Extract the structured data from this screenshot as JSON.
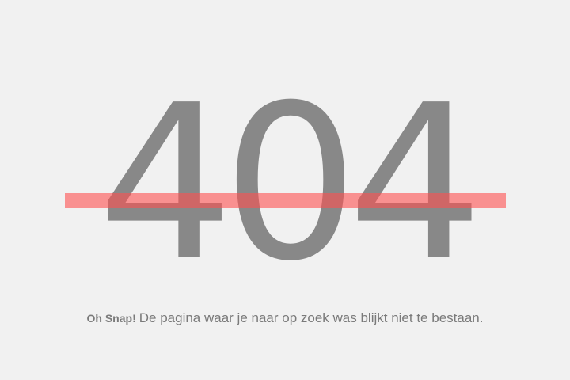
{
  "error": {
    "code": "404",
    "strike_color": "#ff5050"
  },
  "message": {
    "lead": "Oh Snap!",
    "text": "De pagina waar je naar op zoek was blijkt niet te bestaan."
  }
}
